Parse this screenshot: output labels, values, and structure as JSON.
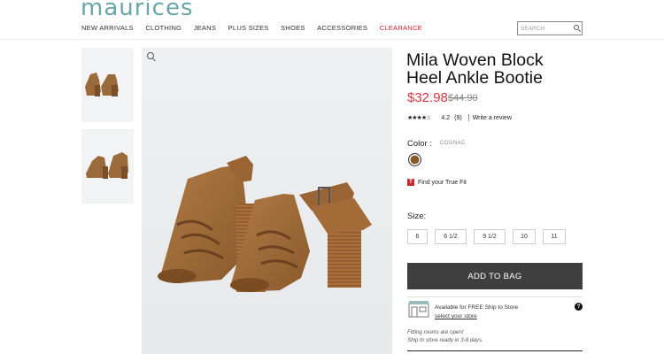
{
  "brand": {
    "logo": "maurices",
    "accent": "#6aa6a7"
  },
  "nav": {
    "items": [
      "NEW ARRIVALS",
      "CLOTHING",
      "JEANS",
      "PLUS SIZES",
      "SHOES",
      "ACCESSORIES"
    ],
    "clearance": "CLEARANCE"
  },
  "search": {
    "placeholder": "SEARCH"
  },
  "product": {
    "title": "Mila Woven Block Heel Ankle Bootie",
    "price": "$32.98",
    "original_price": "$44.90",
    "rating_value": "4.2",
    "rating_stars": "★★★★☆",
    "rating_count": "(9)",
    "write_review": "Write a review",
    "color_label": "Color :",
    "color_name": "COGNAC",
    "swatch_color": "#8a5a2b",
    "truefit_text": "Find your True Fit",
    "size_label": "Size:",
    "sizes": [
      "6",
      "6 1/2",
      "9 1/2",
      "10",
      "11"
    ],
    "add_to_bag": "ADD TO BAG",
    "ship_line1": "Available for FREE Ship to Store",
    "ship_line2": "select your store",
    "fit_line1": "Fitting rooms are open!",
    "fit_line2": "Ship to store ready in 3-8 days."
  }
}
